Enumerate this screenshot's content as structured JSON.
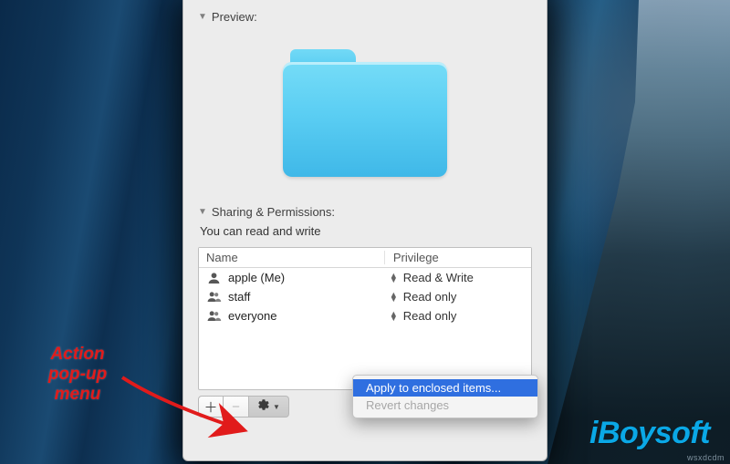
{
  "preview": {
    "header": "Preview:"
  },
  "permissions": {
    "header": "Sharing & Permissions:",
    "info": "You can read and write",
    "columns": {
      "name": "Name",
      "privilege": "Privilege"
    },
    "rows": [
      {
        "name": "apple (Me)",
        "priv": "Read & Write",
        "icon": "single"
      },
      {
        "name": "staff",
        "priv": "Read only",
        "icon": "group"
      },
      {
        "name": "everyone",
        "priv": "Read only",
        "icon": "group"
      }
    ]
  },
  "popup": {
    "items": [
      {
        "label": "Apply to enclosed items...",
        "selected": true,
        "enabled": true
      },
      {
        "label": "Revert changes",
        "selected": false,
        "enabled": false
      }
    ]
  },
  "annotation": {
    "line1": "Action",
    "line2": "pop-up",
    "line3": "menu"
  },
  "branding": {
    "logo": "iBoysoft",
    "watermark": "wsxdcdm"
  }
}
